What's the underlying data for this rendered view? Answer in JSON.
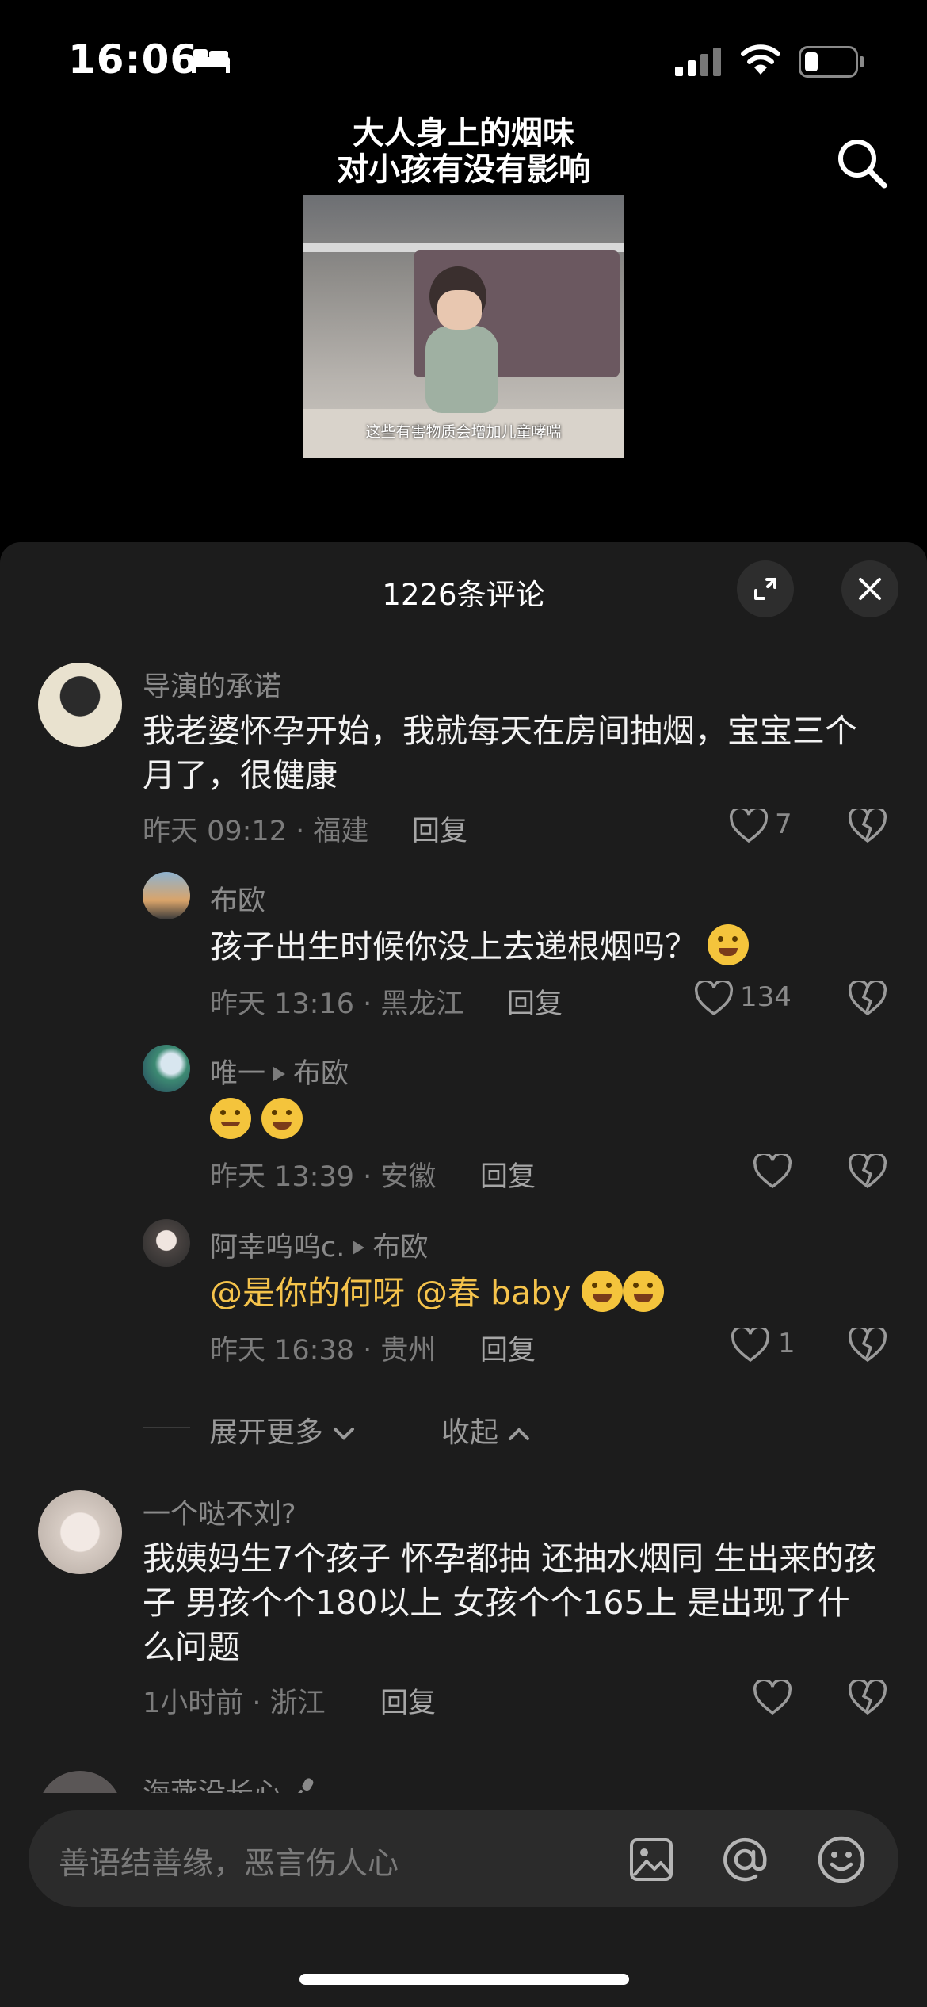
{
  "status_bar": {
    "time": "16:06",
    "icons": [
      "bed-icon",
      "signal-icon",
      "wifi-icon",
      "battery-icon"
    ]
  },
  "video": {
    "title_line1": "大人身上的烟味",
    "title_line2": "对小孩有没有影响",
    "thumbnail_caption": "这些有害物质会增加儿童哮喘"
  },
  "comments_header": {
    "title": "1226条评论"
  },
  "comments": [
    {
      "username": "导演的承诺",
      "text": "我老婆怀孕开始，我就每天在房间抽烟，宝宝三个月了，很健康",
      "meta": "昨天 09:12 · 福建",
      "reply_label": "回复",
      "likes": "7"
    },
    {
      "username": "一个哒不刘?",
      "text": "我姨妈生7个孩子 怀孕都抽 还抽水烟同 生出来的孩子 男孩个个180以上 女孩个个165上 是出现了什么问题",
      "meta": "1小时前 · 浙江",
      "reply_label": "回复",
      "likes": ""
    },
    {
      "username": "海燕没长心"
    }
  ],
  "replies": [
    {
      "username": "布欧",
      "text": "孩子出生时候你没上去递根烟吗？",
      "meta": "昨天 13:16 · 黑龙江",
      "reply_label": "回复",
      "likes": "134"
    },
    {
      "username": "唯一",
      "reply_to": "布欧",
      "meta": "昨天 13:39 · 安徽",
      "reply_label": "回复",
      "likes": ""
    },
    {
      "username": "阿幸呜呜c.",
      "reply_to": "布欧",
      "mention1": "@是你的何呀",
      "mention2": "@春 baby",
      "meta": "昨天 16:38 · 贵州",
      "reply_label": "回复",
      "likes": "1"
    }
  ],
  "thread_controls": {
    "expand_more": "展开更多",
    "collapse": "收起"
  },
  "input": {
    "placeholder": "善语结善缘，恶言伤人心"
  },
  "colors": {
    "sheet_bg": "#1c1c1c",
    "mention": "#f5c34b",
    "muted": "#7c7c7c"
  }
}
